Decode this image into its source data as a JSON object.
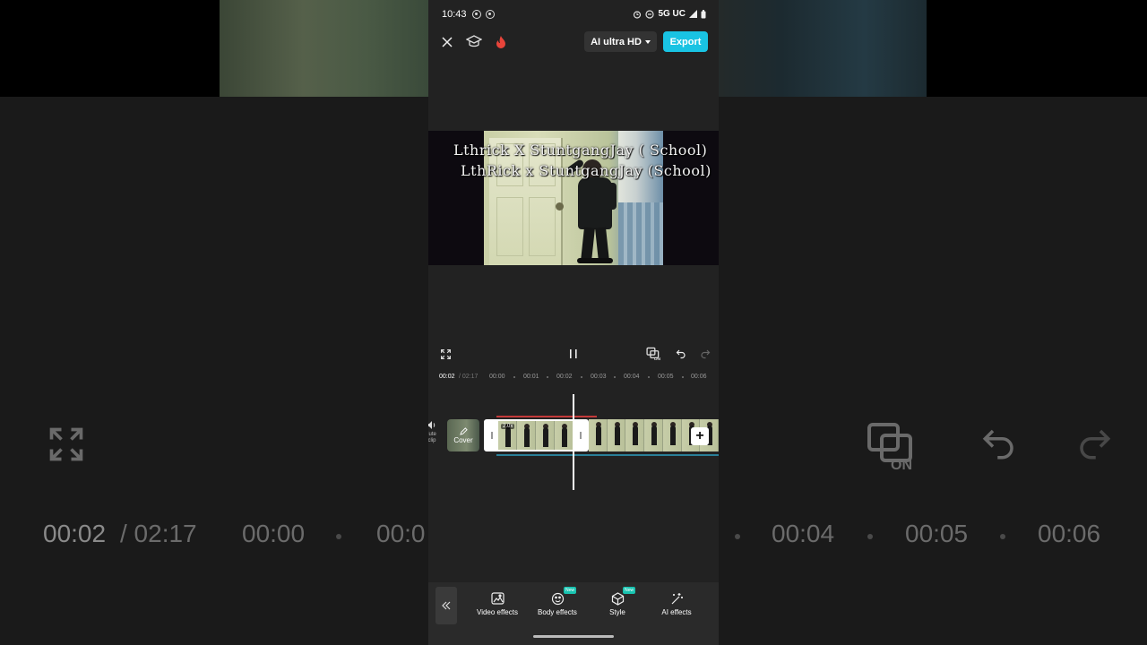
{
  "status_bar": {
    "time": "10:43",
    "network": "5G UC"
  },
  "top_bar": {
    "quality_label": "AI ultra HD",
    "export_label": "Export"
  },
  "preview": {
    "overlay_line1": "Lthrick X StuntgangJay ( School)",
    "overlay_line2": "LthRick x StuntgangJay (School)"
  },
  "timeline": {
    "current_time": "00:02",
    "total_time": "/ 02:17",
    "ticks": [
      "00:00",
      "00:01",
      "00:02",
      "00:03",
      "00:04",
      "00:05",
      "00:06"
    ],
    "mute_label": "lute clip",
    "cover_label": "Cover",
    "speed_badge": "2.0x"
  },
  "toolbar": {
    "tools": [
      {
        "label": "Video effects",
        "icon": "video-effects-icon",
        "is_new": false
      },
      {
        "label": "Body effects",
        "icon": "body-effects-icon",
        "is_new": true
      },
      {
        "label": "Style",
        "icon": "style-icon",
        "is_new": true
      },
      {
        "label": "AI effects",
        "icon": "ai-effects-icon",
        "is_new": false
      }
    ],
    "new_badge": "New"
  },
  "background": {
    "big_current_time": "00:02",
    "big_total_time": "/ 02:17",
    "big_ticks": [
      "00:00",
      "00:0",
      "00:04",
      "00:05",
      "00:06"
    ]
  },
  "colors": {
    "accent": "#19c3e3",
    "panel": "#222222",
    "toolbar": "#2a2a2a"
  }
}
